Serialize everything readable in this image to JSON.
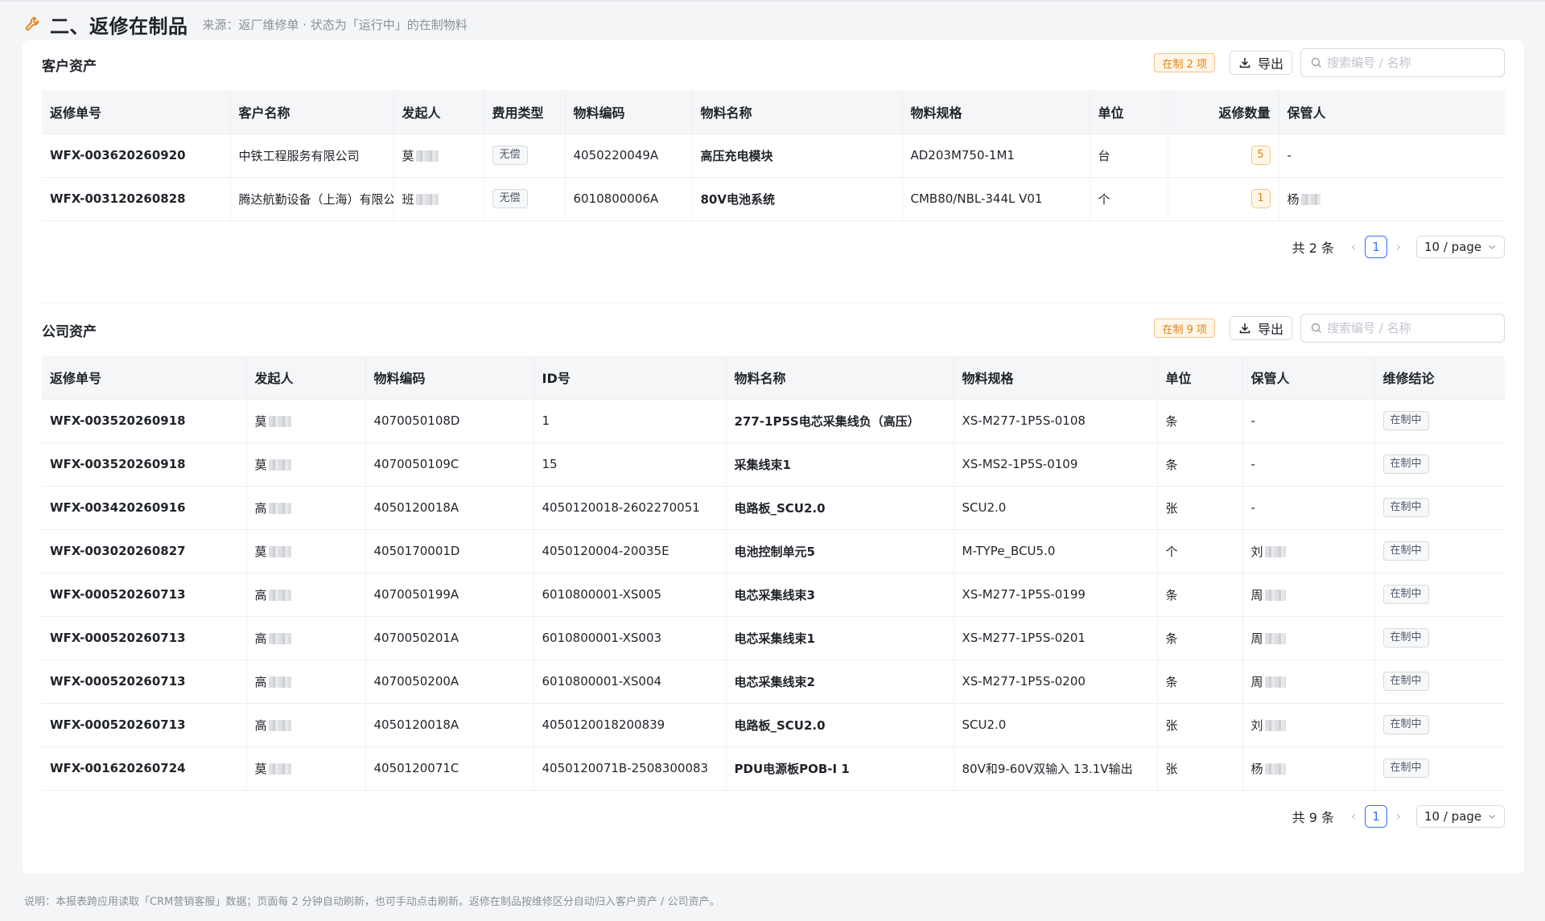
{
  "header": {
    "title": "二、返修在制品",
    "source": "来源：返厂维修单 · 状态为「运行中」的在制物料"
  },
  "customer": {
    "title": "客户资产",
    "badge": "在制 2 项",
    "export_label": "导出",
    "search_placeholder": "搜索编号 / 名称",
    "columns": [
      "返修单号",
      "客户名称",
      "发起人",
      "费用类型",
      "物料编码",
      "物料名称",
      "物料规格",
      "单位",
      "返修数量",
      "保管人"
    ],
    "rows": [
      {
        "order": "WFX-003620260920",
        "customer": "中铁工程服务有限公司",
        "initiator": "莫",
        "fee": "无偿",
        "code": "4050220049A",
        "name": "高压充电模块",
        "spec": "AD203M750-1M1",
        "unit": "台",
        "qty": "5",
        "keeper": "-"
      },
      {
        "order": "WFX-003120260828",
        "customer": "腾达航勤设备（上海）有限公司",
        "initiator": "班",
        "fee": "无偿",
        "code": "6010800006A",
        "name": "80V电池系统",
        "spec": "CMB80/NBL-344L V01",
        "unit": "个",
        "qty": "1",
        "keeper": "杨"
      }
    ],
    "total": "共 2 条",
    "page": "1",
    "page_size": "10 / page"
  },
  "company": {
    "title": "公司资产",
    "badge": "在制 9 项",
    "export_label": "导出",
    "search_placeholder": "搜索编号 / 名称",
    "columns": [
      "返修单号",
      "发起人",
      "物料编码",
      "ID号",
      "物料名称",
      "物料规格",
      "单位",
      "保管人",
      "维修结论"
    ],
    "rows": [
      {
        "order": "WFX-003520260918",
        "initiator": "莫",
        "code": "4070050108D",
        "id": "1",
        "name": "277-1P5S电芯采集线负（高压）",
        "spec": "XS-M277-1P5S-0108",
        "unit": "条",
        "keeper": "-",
        "status": "在制中"
      },
      {
        "order": "WFX-003520260918",
        "initiator": "莫",
        "code": "4070050109C",
        "id": "15",
        "name": "采集线束1",
        "spec": "XS-MS2-1P5S-0109",
        "unit": "条",
        "keeper": "-",
        "status": "在制中"
      },
      {
        "order": "WFX-003420260916",
        "initiator": "高",
        "code": "4050120018A",
        "id": "4050120018-2602270051",
        "name": "电路板_SCU2.0",
        "spec": "SCU2.0",
        "unit": "张",
        "keeper": "-",
        "status": "在制中"
      },
      {
        "order": "WFX-003020260827",
        "initiator": "莫",
        "code": "4050170001D",
        "id": "4050120004-20035E",
        "name": "电池控制单元5",
        "spec": "M-TYPe_BCU5.0",
        "unit": "个",
        "keeper": "刘",
        "status": "在制中"
      },
      {
        "order": "WFX-000520260713",
        "initiator": "高",
        "code": "4070050199A",
        "id": "6010800001-XS005",
        "name": "电芯采集线束3",
        "spec": "XS-M277-1P5S-0199",
        "unit": "条",
        "keeper": "周",
        "status": "在制中"
      },
      {
        "order": "WFX-000520260713",
        "initiator": "高",
        "code": "4070050201A",
        "id": "6010800001-XS003",
        "name": "电芯采集线束1",
        "spec": "XS-M277-1P5S-0201",
        "unit": "条",
        "keeper": "周",
        "status": "在制中"
      },
      {
        "order": "WFX-000520260713",
        "initiator": "高",
        "code": "4070050200A",
        "id": "6010800001-XS004",
        "name": "电芯采集线束2",
        "spec": "XS-M277-1P5S-0200",
        "unit": "条",
        "keeper": "周",
        "status": "在制中"
      },
      {
        "order": "WFX-000520260713",
        "initiator": "高",
        "code": "4050120018A",
        "id": "4050120018200839",
        "name": "电路板_SCU2.0",
        "spec": "SCU2.0",
        "unit": "张",
        "keeper": "刘",
        "status": "在制中"
      },
      {
        "order": "WFX-001620260724",
        "initiator": "莫",
        "code": "4050120071C",
        "id": "4050120071B-2508300083",
        "name": "PDU电源板POB-I 1",
        "spec": "80V和9-60V双输入 13.1V输出",
        "unit": "张",
        "keeper": "杨",
        "status": "在制中"
      }
    ],
    "total": "共 9 条",
    "page": "1",
    "page_size": "10 / page"
  },
  "footer": {
    "note": "说明：本报表跨应用读取「CRM营销客服」数据；页面每 2 分钟自动刷新，也可手动点击刷新。返修在制品按维修区分自动归入客户资产 / 公司资产。"
  },
  "colors": {
    "accent": "#e0831c",
    "primary": "#3370ff"
  }
}
